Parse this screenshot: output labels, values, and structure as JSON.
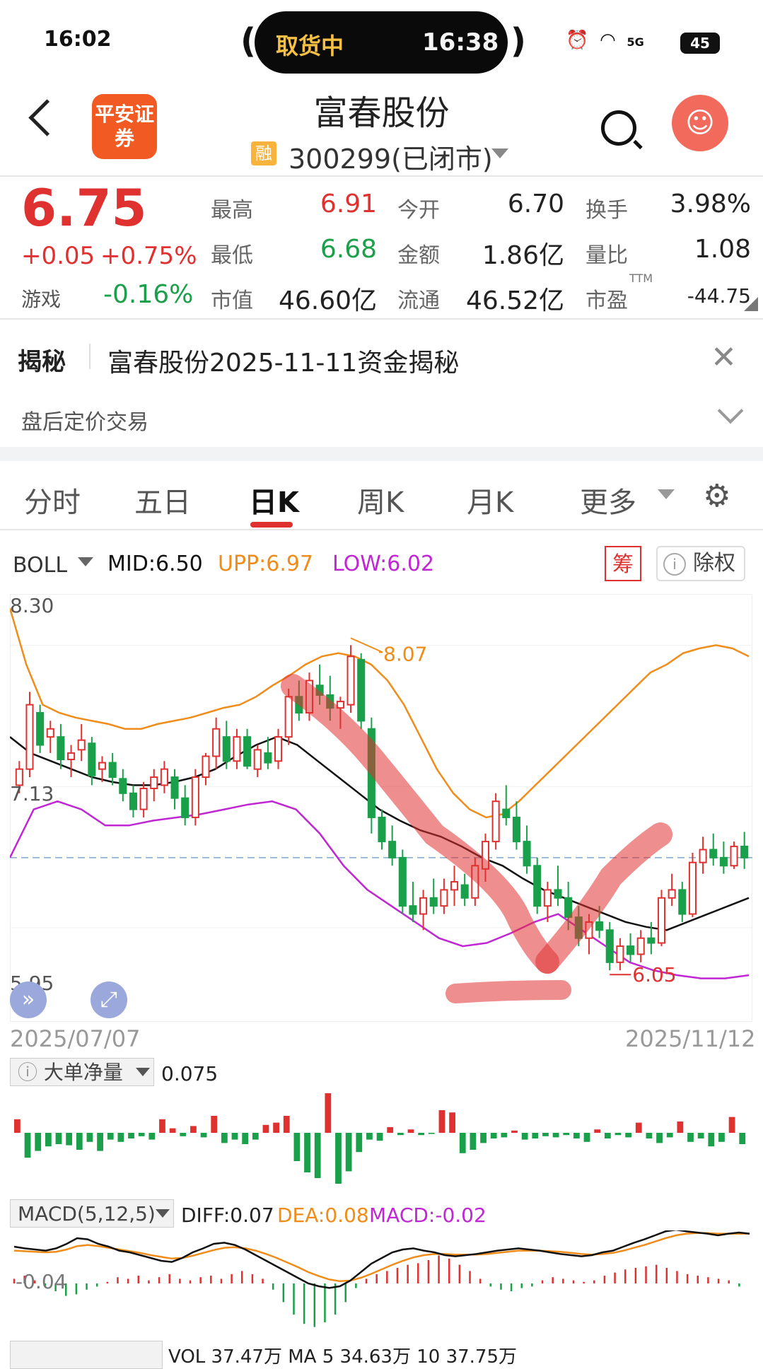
{
  "status_bar": {
    "time": "16:02",
    "pill_left": "取货中",
    "pill_right": "16:38",
    "signal": "5G",
    "battery": "45"
  },
  "header": {
    "logo_text": "平安证券",
    "title": "富春股份",
    "badge": "融",
    "code": "300299",
    "market_state": "(已闭市)"
  },
  "quote": {
    "price": "6.75",
    "change": "+0.05",
    "change_pct": "+0.75%",
    "sector_name": "游戏",
    "sector_change": "-0.16%",
    "fields": [
      {
        "label": "最高",
        "value": "6.91",
        "tone": "red"
      },
      {
        "label": "今开",
        "value": "6.70",
        "tone": "dark"
      },
      {
        "label": "换手",
        "value": "3.98%",
        "tone": "dark"
      },
      {
        "label": "最低",
        "value": "6.68",
        "tone": "green"
      },
      {
        "label": "金额",
        "value": "1.86亿",
        "tone": "dark"
      },
      {
        "label": "量比",
        "value": "1.08",
        "tone": "dark"
      },
      {
        "label": "市值",
        "value": "46.60亿",
        "tone": "dark"
      },
      {
        "label": "流通",
        "value": "46.52亿",
        "tone": "dark"
      },
      {
        "label": "市盈",
        "value": "-44.75",
        "tone": "dark"
      }
    ],
    "pe_sup": "TTM"
  },
  "news": {
    "tag": "揭秘",
    "headline": "富春股份2025-11-11资金揭秘",
    "after_hours": "盘后定价交易"
  },
  "tabs": [
    "分时",
    "五日",
    "日K",
    "周K",
    "月K",
    "更多"
  ],
  "active_tab": "日K",
  "indicator": {
    "name": "BOLL",
    "mid": "MID:6.50",
    "upp": "UPP:6.97",
    "low": "LOW:6.02",
    "chip_btn": "筹",
    "exright_btn": "除权"
  },
  "colors": {
    "up": "#e03131",
    "down": "#1aa04a",
    "upp": "#f08c1a",
    "low": "#c026d3",
    "mid": "#111111"
  },
  "chart_data": {
    "type": "candlestick",
    "y_ticks": [
      "8.30",
      "7.13",
      "5.95"
    ],
    "max_label": "8.07",
    "min_label": "6.05",
    "start_date": "2025/07/07",
    "end_date": "2025/11/12",
    "ohlc": [
      [
        7.2,
        7.35,
        7.15,
        7.3
      ],
      [
        7.3,
        7.78,
        7.25,
        7.7
      ],
      [
        7.65,
        7.7,
        7.4,
        7.45
      ],
      [
        7.5,
        7.6,
        7.4,
        7.55
      ],
      [
        7.5,
        7.58,
        7.3,
        7.36
      ],
      [
        7.36,
        7.45,
        7.25,
        7.4
      ],
      [
        7.42,
        7.58,
        7.35,
        7.48
      ],
      [
        7.46,
        7.5,
        7.2,
        7.26
      ],
      [
        7.3,
        7.38,
        7.22,
        7.34
      ],
      [
        7.34,
        7.4,
        7.2,
        7.25
      ],
      [
        7.24,
        7.3,
        7.1,
        7.15
      ],
      [
        7.15,
        7.2,
        7.0,
        7.05
      ],
      [
        7.05,
        7.22,
        7.0,
        7.18
      ],
      [
        7.18,
        7.3,
        7.1,
        7.25
      ],
      [
        7.2,
        7.35,
        7.15,
        7.3
      ],
      [
        7.25,
        7.3,
        7.05,
        7.12
      ],
      [
        7.12,
        7.2,
        6.95,
        7.0
      ],
      [
        7.0,
        7.3,
        6.95,
        7.25
      ],
      [
        7.25,
        7.4,
        7.2,
        7.38
      ],
      [
        7.38,
        7.62,
        7.3,
        7.55
      ],
      [
        7.5,
        7.6,
        7.3,
        7.35
      ],
      [
        7.35,
        7.55,
        7.3,
        7.5
      ],
      [
        7.5,
        7.55,
        7.3,
        7.32
      ],
      [
        7.3,
        7.45,
        7.25,
        7.42
      ],
      [
        7.4,
        7.5,
        7.3,
        7.34
      ],
      [
        7.35,
        7.55,
        7.3,
        7.5
      ],
      [
        7.5,
        7.8,
        7.45,
        7.75
      ],
      [
        7.75,
        7.85,
        7.6,
        7.65
      ],
      [
        7.65,
        7.9,
        7.6,
        7.85
      ],
      [
        7.82,
        7.95,
        7.7,
        7.76
      ],
      [
        7.76,
        7.88,
        7.6,
        7.68
      ],
      [
        7.68,
        7.75,
        7.55,
        7.72
      ],
      [
        7.7,
        8.07,
        7.65,
        8.0
      ],
      [
        7.98,
        8.02,
        7.55,
        7.6
      ],
      [
        7.55,
        7.62,
        6.9,
        7.0
      ],
      [
        7.0,
        7.05,
        6.8,
        6.85
      ],
      [
        6.85,
        6.95,
        6.7,
        6.75
      ],
      [
        6.75,
        6.8,
        6.4,
        6.45
      ],
      [
        6.45,
        6.6,
        6.35,
        6.4
      ],
      [
        6.4,
        6.55,
        6.3,
        6.5
      ],
      [
        6.5,
        6.62,
        6.4,
        6.45
      ],
      [
        6.45,
        6.62,
        6.4,
        6.55
      ],
      [
        6.55,
        6.7,
        6.45,
        6.6
      ],
      [
        6.58,
        6.65,
        6.45,
        6.5
      ],
      [
        6.5,
        6.75,
        6.45,
        6.7
      ],
      [
        6.68,
        6.9,
        6.6,
        6.85
      ],
      [
        6.85,
        7.15,
        6.8,
        7.1
      ],
      [
        7.05,
        7.2,
        6.95,
        7.0
      ],
      [
        7.0,
        7.1,
        6.8,
        6.85
      ],
      [
        6.85,
        6.95,
        6.65,
        6.7
      ],
      [
        6.7,
        6.75,
        6.4,
        6.45
      ],
      [
        6.45,
        6.6,
        6.35,
        6.55
      ],
      [
        6.55,
        6.7,
        6.45,
        6.5
      ],
      [
        6.5,
        6.6,
        6.3,
        6.38
      ],
      [
        6.38,
        6.45,
        6.2,
        6.25
      ],
      [
        6.25,
        6.4,
        6.15,
        6.35
      ],
      [
        6.35,
        6.45,
        6.25,
        6.3
      ],
      [
        6.3,
        6.35,
        6.05,
        6.1
      ],
      [
        6.1,
        6.25,
        6.05,
        6.2
      ],
      [
        6.2,
        6.28,
        6.1,
        6.15
      ],
      [
        6.15,
        6.3,
        6.1,
        6.25
      ],
      [
        6.25,
        6.35,
        6.15,
        6.22
      ],
      [
        6.22,
        6.55,
        6.2,
        6.5
      ],
      [
        6.5,
        6.65,
        6.45,
        6.55
      ],
      [
        6.55,
        6.6,
        6.35,
        6.4
      ],
      [
        6.4,
        6.78,
        6.38,
        6.72
      ],
      [
        6.72,
        6.88,
        6.65,
        6.8
      ],
      [
        6.8,
        6.9,
        6.7,
        6.75
      ],
      [
        6.75,
        6.85,
        6.65,
        6.7
      ],
      [
        6.7,
        6.85,
        6.68,
        6.82
      ],
      [
        6.82,
        6.91,
        6.68,
        6.75
      ]
    ],
    "upper_band": [
      8.3,
      7.95,
      7.7,
      7.65,
      7.62,
      7.6,
      7.58,
      7.55,
      7.55,
      7.58,
      7.6,
      7.62,
      7.65,
      7.68,
      7.7,
      7.75,
      7.82,
      7.88,
      7.95,
      8.0,
      8.02,
      8.0,
      7.95,
      7.85,
      7.7,
      7.5,
      7.3,
      7.15,
      7.05,
      7.0,
      7.02,
      7.1,
      7.2,
      7.3,
      7.4,
      7.5,
      7.6,
      7.7,
      7.8,
      7.9,
      7.95,
      8.02,
      8.05,
      8.07,
      8.05,
      8.0
    ],
    "mid_band": [
      7.5,
      7.4,
      7.35,
      7.3,
      7.25,
      7.22,
      7.2,
      7.2,
      7.22,
      7.25,
      7.3,
      7.38,
      7.45,
      7.5,
      7.45,
      7.35,
      7.25,
      7.15,
      7.05,
      6.98,
      6.92,
      6.88,
      6.82,
      6.75,
      6.7,
      6.62,
      6.55,
      6.5,
      6.45,
      6.4,
      6.35,
      6.32,
      6.3,
      6.35,
      6.4,
      6.45,
      6.5
    ],
    "lower_band": [
      6.75,
      7.05,
      7.1,
      7.05,
      6.95,
      6.95,
      6.98,
      7.0,
      7.02,
      7.05,
      7.08,
      7.1,
      7.05,
      6.9,
      6.7,
      6.55,
      6.45,
      6.35,
      6.25,
      6.2,
      6.22,
      6.28,
      6.35,
      6.4,
      6.3,
      6.2,
      6.1,
      6.05,
      6.02,
      6.0,
      6.0,
      6.02
    ],
    "big_order": {
      "label": "大单净量",
      "value": "0.075"
    },
    "macd": {
      "label": "MACD(5,12,5)",
      "diff": "DIFF:0.07",
      "dea": "DEA:0.08",
      "macd": "MACD:-0.02",
      "axis_label": "-0.04"
    },
    "vol_partial": "VOL 37.47万 MA 5 34.63万 10 37.75万"
  }
}
